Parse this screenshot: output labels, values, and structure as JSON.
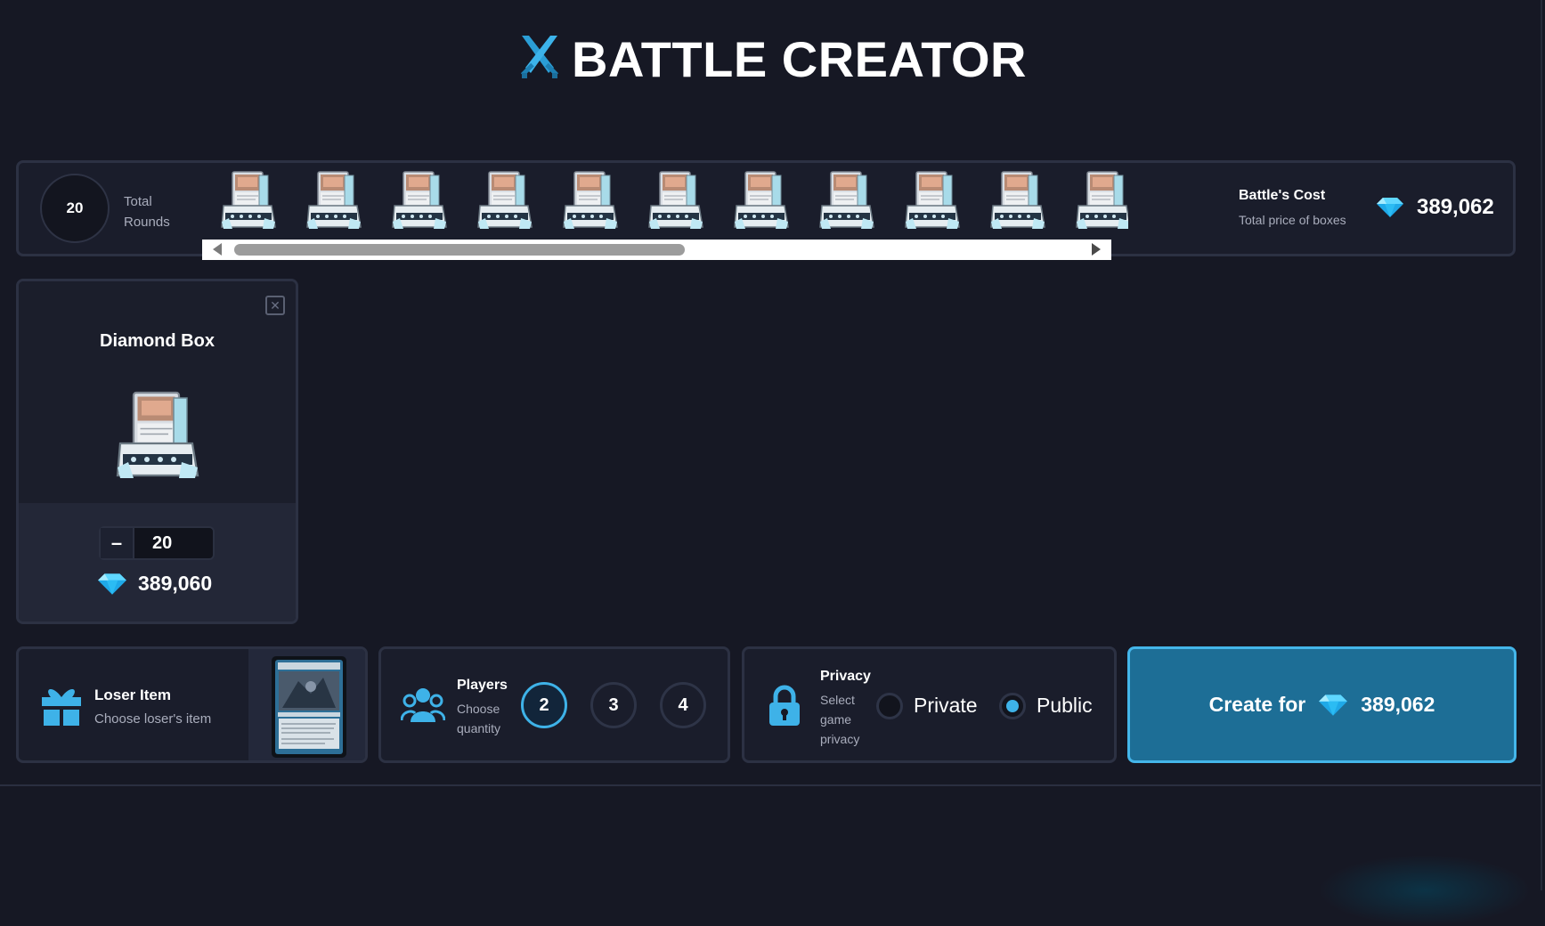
{
  "header": {
    "title": "BATTLE CREATOR",
    "icon": "crossed-swords-icon"
  },
  "rounds": {
    "count": "20",
    "label": "Total Rounds",
    "visible_boxes": 11,
    "cost_title": "Battle's Cost",
    "cost_subtitle": "Total price of boxes",
    "cost_value": "389,062"
  },
  "box_card": {
    "name": "Diamond Box",
    "quantity": "20",
    "minus_label": "–",
    "price": "389,060"
  },
  "loser_item": {
    "title": "Loser Item",
    "subtitle": "Choose loser's item"
  },
  "players": {
    "title": "Players",
    "subtitle": "Choose quantity",
    "options": [
      "2",
      "3",
      "4"
    ],
    "selected": "2"
  },
  "privacy": {
    "title": "Privacy",
    "subtitle": "Select game privacy",
    "options": [
      "Private",
      "Public"
    ],
    "selected": "Public"
  },
  "create_button": {
    "label": "Create for",
    "value": "389,062"
  },
  "colors": {
    "accent": "#3eb2e8",
    "button": "#1d6e96",
    "background": "#161824",
    "panel": "#1a1d2b",
    "gem": "#39c6f5"
  }
}
